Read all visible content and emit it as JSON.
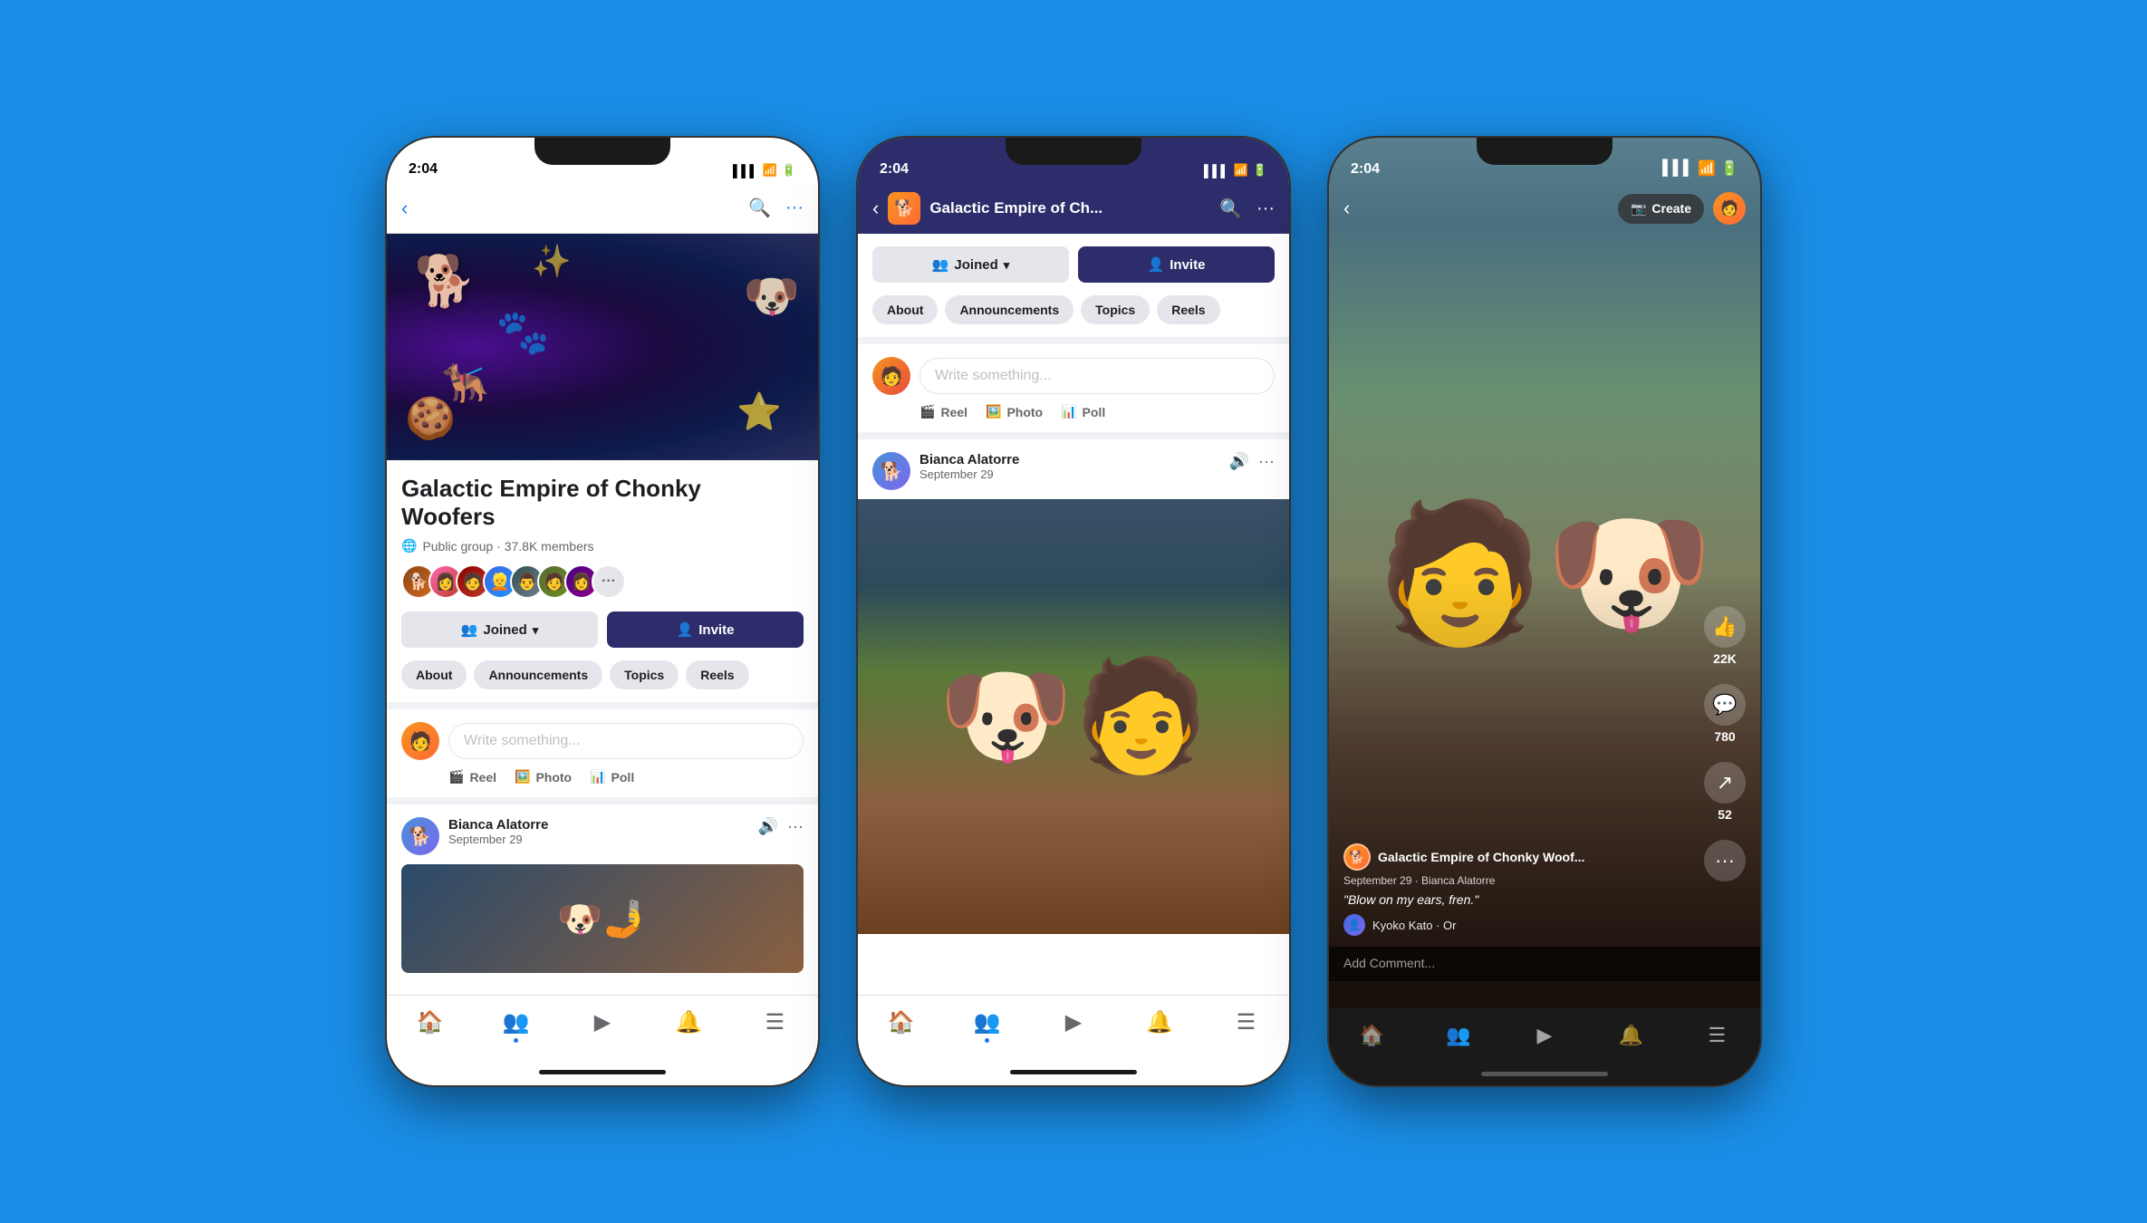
{
  "background": "#1a8fe8",
  "phones": [
    {
      "id": "phone1",
      "status_bar": {
        "time": "2:04",
        "signal": "▌▌▌",
        "wifi": "WiFi",
        "battery": "▮▮▮"
      },
      "nav": {
        "back_label": "‹",
        "search_label": "🔍",
        "more_label": "···"
      },
      "group": {
        "name_line1": "Galactic Empire of Chonky",
        "name_line2": "Woofers",
        "meta": "Public group · 37.8K members",
        "member_count": "37.8K"
      },
      "buttons": {
        "joined": "Joined",
        "invite": "Invite"
      },
      "tabs": [
        "About",
        "Announcements",
        "Topics",
        "Reels"
      ],
      "write_placeholder": "Write something...",
      "media_actions": [
        "Reel",
        "Photo",
        "Poll"
      ],
      "post": {
        "author": "Bianca Alatorre",
        "date": "September 29"
      },
      "bottom_nav": [
        "🏠",
        "👥",
        "▶",
        "🔔",
        "☰"
      ]
    },
    {
      "id": "phone2",
      "status_bar": {
        "time": "2:04",
        "signal": "▌▌▌",
        "wifi": "WiFi",
        "battery": "▮▮▮"
      },
      "nav": {
        "back_label": "‹",
        "title": "Galactic Empire of Ch...",
        "search_label": "🔍",
        "more_label": "···"
      },
      "buttons": {
        "joined": "Joined",
        "invite": "Invite"
      },
      "tabs": [
        "About",
        "Announcements",
        "Topics",
        "Reels"
      ],
      "write_placeholder": "Write something...",
      "media_actions": [
        "Reel",
        "Photo",
        "Poll"
      ],
      "post": {
        "author": "Bianca Alatorre",
        "date": "September 29"
      },
      "bottom_nav": [
        "🏠",
        "👥",
        "▶",
        "🔔",
        "☰"
      ]
    },
    {
      "id": "phone3",
      "status_bar": {
        "time": "2:04",
        "signal": "▌▌▌",
        "wifi": "WiFi",
        "battery": "▮▮▮"
      },
      "nav": {
        "back_label": "‹",
        "create_label": "Create"
      },
      "reel": {
        "group_name": "Galactic Empire of Chonky Woof...",
        "date": "September 29 · Bianca Alatorre",
        "caption": "\"Blow on my ears, fren.\"",
        "likes": "22K",
        "comments": "780",
        "shares": "52",
        "commenter": "Kyoko Kato · Or"
      },
      "add_comment": "Add Comment...",
      "bottom_nav": [
        "🏠",
        "👥",
        "▶",
        "🔔",
        "☰"
      ]
    }
  ]
}
